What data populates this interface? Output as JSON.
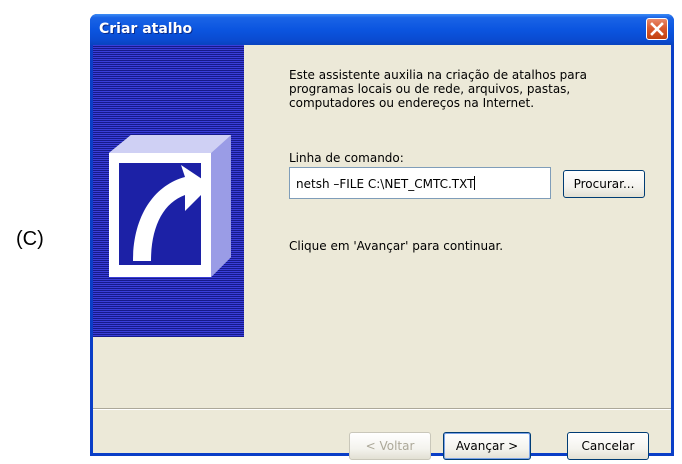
{
  "figure": {
    "label": "(C)"
  },
  "window": {
    "title": "Criar atalho"
  },
  "wizard": {
    "description": "Este assistente auxilia na criação de atalhos para programas locais ou de rede, arquivos, pastas, computadores ou endereços na Internet.",
    "command_label": "Linha de comando:",
    "command_value": "netsh –FILE C:\\NET_CMTC.TXT",
    "browse_label": "Procurar...",
    "hint": "Clique em 'Avançar' para continuar."
  },
  "buttons": {
    "back": "< Voltar",
    "next": "Avançar >",
    "cancel": "Cancelar"
  },
  "colors": {
    "titlebar": "#0b55e0",
    "client": "#ece9d8",
    "banner": "#2024a8",
    "close": "#d95a2e"
  },
  "icons": {
    "close": "close-icon",
    "shortcut": "shortcut-arrow-icon"
  }
}
